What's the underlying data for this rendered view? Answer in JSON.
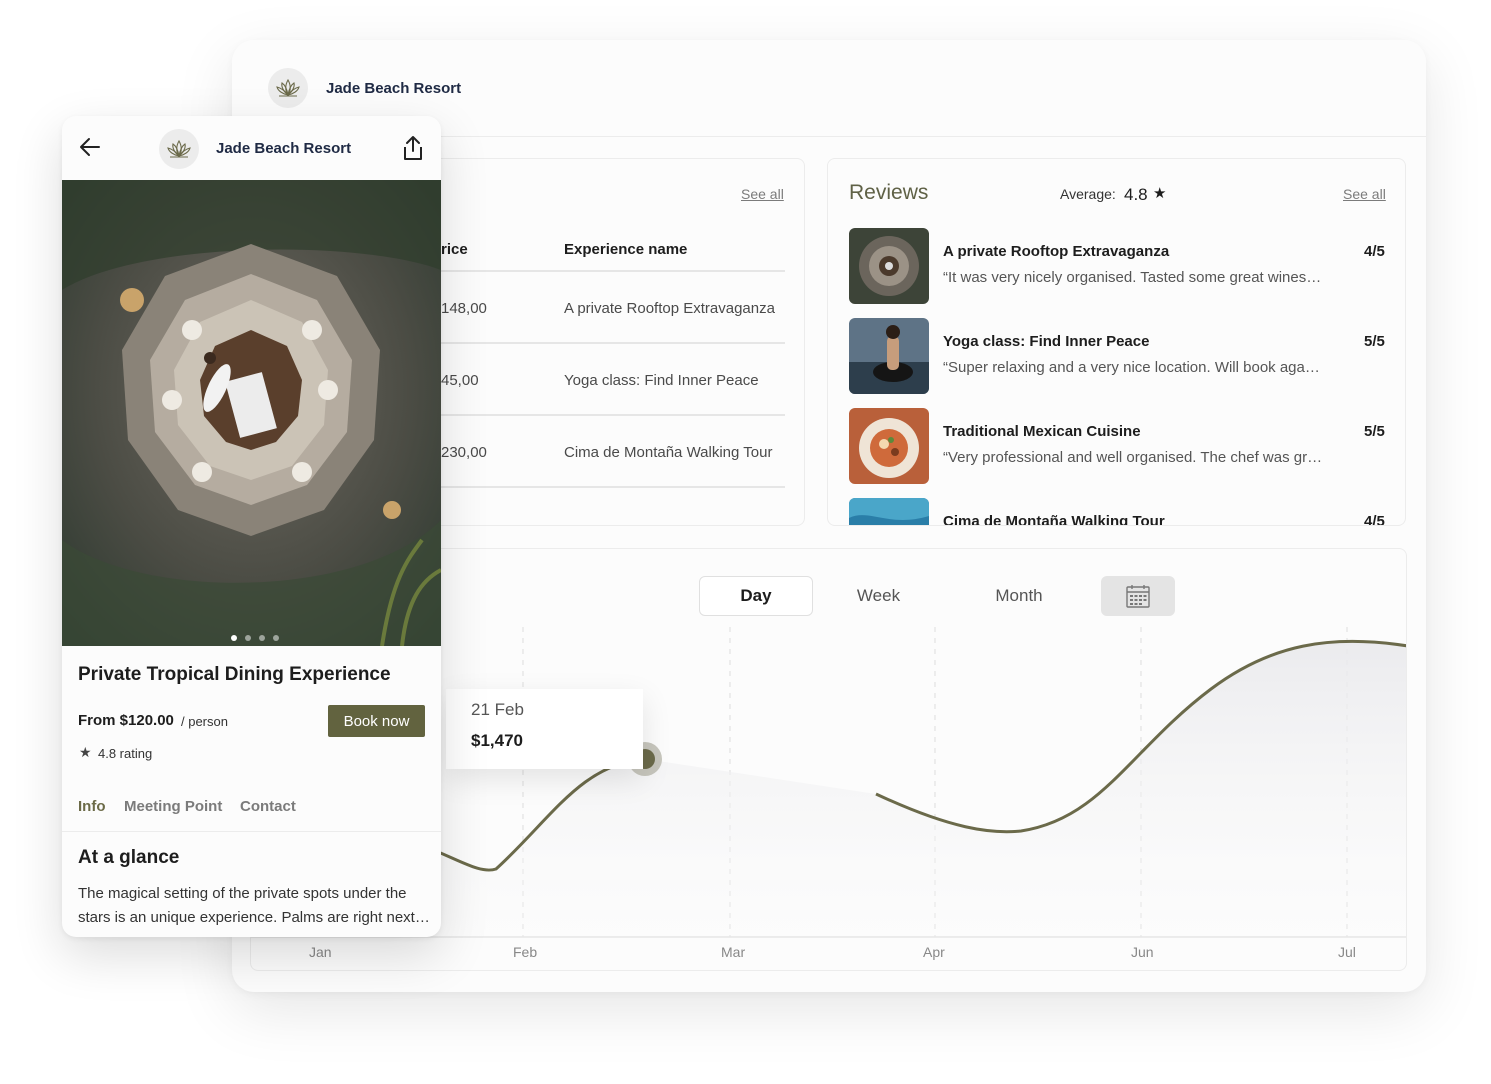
{
  "desktop": {
    "brand": "Jade Beach Resort",
    "bookings": {
      "see_all": "See all",
      "columns": [
        "rice",
        "Experience name"
      ],
      "rows": [
        {
          "price": "148,00",
          "name": "A private Rooftop Extravaganza"
        },
        {
          "price": "45,00",
          "name": "Yoga class: Find Inner Peace"
        },
        {
          "price": "230,00",
          "name": "Cima de Montaña Walking Tour"
        }
      ]
    },
    "reviews": {
      "title": "Reviews",
      "average_label": "Average:",
      "average_value": "4.8",
      "see_all": "See all",
      "items": [
        {
          "name": "A private Rooftop Extravaganza",
          "score": "4/5",
          "quote": "“It was very nicely organised. Tasted some great wines and the food was amazing."
        },
        {
          "name": "Yoga class: Find Inner Peace",
          "score": "5/5",
          "quote": "“Super relaxing and a very nice location. Will book again next time for sure."
        },
        {
          "name": "Traditional Mexican Cuisine",
          "score": "5/5",
          "quote": "“Very professional and well organised. The chef was great and super friendly."
        },
        {
          "name": "Cima de Montaña Walking Tour",
          "score": "4/5",
          "quote": ""
        }
      ]
    },
    "chart": {
      "segments": [
        "Day",
        "Week",
        "Month"
      ],
      "active_segment": "Day",
      "months": [
        "Jan",
        "Feb",
        "Mar",
        "Apr",
        "Jun",
        "Jul"
      ],
      "tooltip": {
        "date": "21 Feb",
        "value": "$1,470"
      },
      "line_color": "#6b6a4a"
    }
  },
  "mobile": {
    "brand": "Jade Beach Resort",
    "title": "Private Tropical Dining Experience",
    "price": "From $120.00",
    "per": "/ person",
    "book_label": "Book now",
    "rating": "4.8 rating",
    "tabs": [
      "Info",
      "Meeting Point",
      "Contact"
    ],
    "section_title": "At a glance",
    "body_line1": "The magical setting of the private spots under the",
    "body_line2": "stars is an unique experience. Palms are right next to you.",
    "accent": "#62633f"
  }
}
